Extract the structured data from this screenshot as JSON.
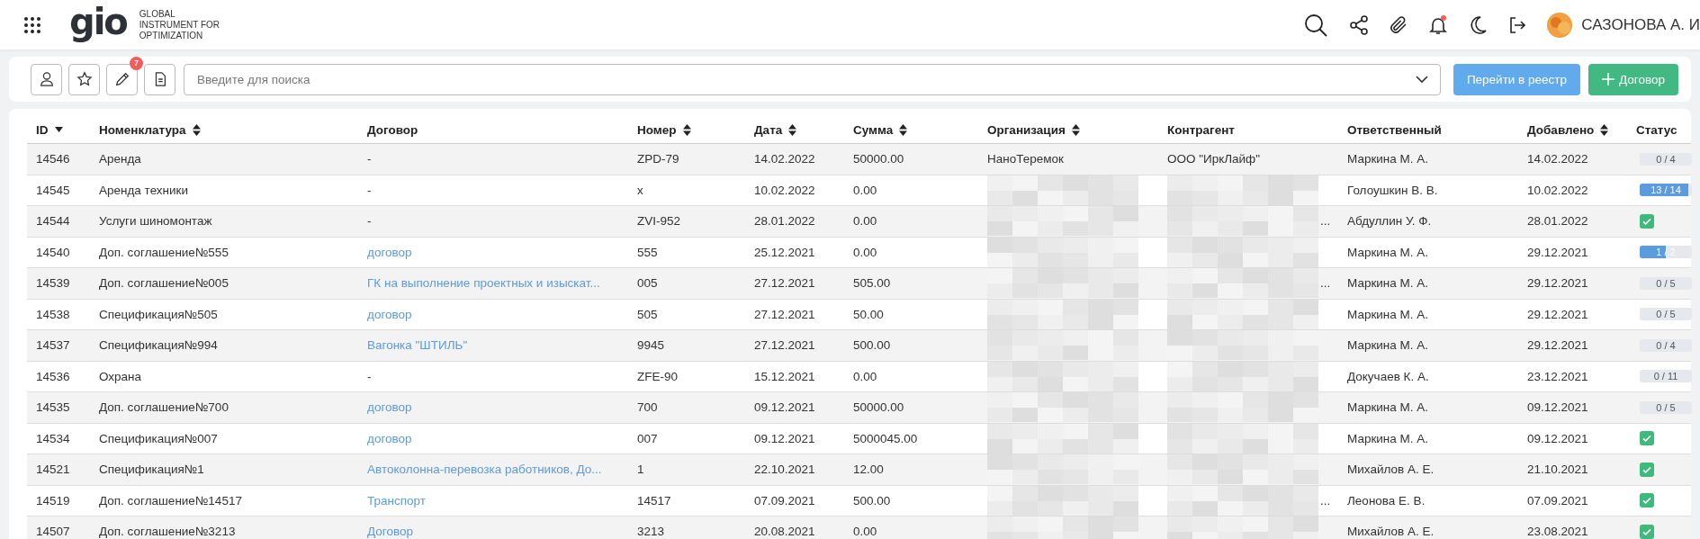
{
  "header": {
    "logo": "gio",
    "logo_caption": [
      "GLOBAL",
      "INSTRUMENT FOR",
      "OPTIMIZATION"
    ],
    "notifications_unread": true,
    "user_name": "САЗОНОВА А. И"
  },
  "toolbar": {
    "pencil_badge": "7",
    "search": {
      "placeholder": "Введите для поиска"
    },
    "buttons": [
      {
        "label": "Перейти в реестр",
        "kind": "primary"
      },
      {
        "label": "Договор",
        "kind": "add"
      }
    ]
  },
  "table": {
    "columns": [
      {
        "label": "ID",
        "sortable": true,
        "sorted_desc": true
      },
      {
        "label": "Номенклатура",
        "sortable": true,
        "sorted_desc": false
      },
      {
        "label": "Договор",
        "sortable": false
      },
      {
        "label": "Номер",
        "sortable": true,
        "sorted_desc": false
      },
      {
        "label": "Дата",
        "sortable": true,
        "sorted_desc": false
      },
      {
        "label": "Сумма",
        "sortable": true,
        "sorted_desc": false
      },
      {
        "label": "Организация",
        "sortable": true,
        "sorted_desc": false
      },
      {
        "label": "Контрагент",
        "sortable": false
      },
      {
        "label": "Ответственный",
        "sortable": false
      },
      {
        "label": "Добавлено",
        "sortable": true,
        "sorted_desc": false
      },
      {
        "label": "Статус",
        "sortable": false
      }
    ],
    "rows": [
      {
        "id": "14546",
        "item": "Аренда",
        "contract": "-",
        "contract_link": false,
        "number": "ZPD-79",
        "date": "14.02.2022",
        "sum": "50000.00",
        "organization": "НаноТеремок",
        "contractor": "ООО \"ИркЛайф\"",
        "redacted": false,
        "responsible": "Маркина М. А.",
        "added": "14.02.2022",
        "status": {
          "kind": "progress",
          "text": "0 / 4",
          "level": 0
        }
      },
      {
        "id": "14545",
        "item": "Аренда техники",
        "contract": "-",
        "contract_link": false,
        "number": "x",
        "date": "10.02.2022",
        "sum": "0.00",
        "redacted": true,
        "responsible": "Голоушкин В. В.",
        "added": "10.02.2022",
        "status": {
          "kind": "progress",
          "text": "13 / 14",
          "level": 0.93
        }
      },
      {
        "id": "14544",
        "item": "Услуги шиномонтаж",
        "contract": "-",
        "contract_link": false,
        "number": "ZVI-952",
        "date": "28.01.2022",
        "sum": "0.00",
        "redacted": true,
        "contractor": "...",
        "responsible": "Абдуллин У. Ф.",
        "added": "28.01.2022",
        "status": {
          "kind": "done"
        }
      },
      {
        "id": "14540",
        "item": "Доп. соглашение№555",
        "contract": "договор",
        "contract_link": true,
        "number": "555",
        "date": "25.12.2021",
        "sum": "0.00",
        "redacted": true,
        "responsible": "Маркина М. А.",
        "added": "29.12.2021",
        "status": {
          "kind": "progress",
          "text": "1 / 2",
          "level": 0.5
        }
      },
      {
        "id": "14539",
        "item": "Доп. соглашение№005",
        "contract": "ГК на выполнение проектных и изыскат...",
        "contract_link": true,
        "number": "005",
        "date": "27.12.2021",
        "sum": "505.00",
        "redacted": true,
        "contractor": "...",
        "responsible": "Маркина М. А.",
        "added": "29.12.2021",
        "status": {
          "kind": "progress",
          "text": "0 / 5",
          "level": 0
        }
      },
      {
        "id": "14538",
        "item": "Спецификация№505",
        "contract": "договор",
        "contract_link": true,
        "number": "505",
        "date": "27.12.2021",
        "sum": "50.00",
        "redacted": true,
        "responsible": "Маркина М. А.",
        "added": "29.12.2021",
        "status": {
          "kind": "progress",
          "text": "0 / 5",
          "level": 0
        }
      },
      {
        "id": "14537",
        "item": "Спецификация№994",
        "contract": "Вагонка \"ШТИЛЬ\"",
        "contract_link": true,
        "number": "9945",
        "date": "27.12.2021",
        "sum": "500.00",
        "redacted": true,
        "responsible": "Маркина М. А.",
        "added": "29.12.2021",
        "status": {
          "kind": "progress",
          "text": "0 / 4",
          "level": 0
        }
      },
      {
        "id": "14536",
        "item": "Охрана",
        "contract": "-",
        "contract_link": false,
        "number": "ZFE-90",
        "date": "15.12.2021",
        "sum": "0.00",
        "redacted": true,
        "responsible": "Докучаев К. А.",
        "added": "23.12.2021",
        "status": {
          "kind": "progress",
          "text": "0 / 11",
          "level": 0
        }
      },
      {
        "id": "14535",
        "item": "Доп. соглашение№700",
        "contract": "договор",
        "contract_link": true,
        "number": "700",
        "date": "09.12.2021",
        "sum": "50000.00",
        "redacted": true,
        "responsible": "Маркина М. А.",
        "added": "09.12.2021",
        "status": {
          "kind": "progress",
          "text": "0 / 5",
          "level": 0
        }
      },
      {
        "id": "14534",
        "item": "Спецификация№007",
        "contract": "договор",
        "contract_link": true,
        "number": "007",
        "date": "09.12.2021",
        "sum": "5000045.00",
        "redacted": true,
        "responsible": "Маркина М. А.",
        "added": "09.12.2021",
        "status": {
          "kind": "done"
        }
      },
      {
        "id": "14521",
        "item": "Спецификация№1",
        "contract": "Автоколонна-перевозка работников, До...",
        "contract_link": true,
        "number": "1",
        "date": "22.10.2021",
        "sum": "12.00",
        "redacted": true,
        "responsible": "Михайлов А. Е.",
        "added": "21.10.2021",
        "status": {
          "kind": "done"
        }
      },
      {
        "id": "14519",
        "item": "Доп. соглашение№14517",
        "contract": "Транспорт",
        "contract_link": true,
        "number": "14517",
        "date": "07.09.2021",
        "sum": "500.00",
        "redacted": true,
        "contractor": "...",
        "responsible": "Леонова Е. В.",
        "added": "07.09.2021",
        "status": {
          "kind": "done"
        }
      },
      {
        "id": "14507",
        "item": "Доп. соглашение№3213",
        "contract": "Договор",
        "contract_link": true,
        "number": "3213",
        "date": "20.08.2021",
        "sum": "0.00",
        "redacted": true,
        "responsible": "Михайлов А. Е.",
        "added": "23.08.2021",
        "status": {
          "kind": "done"
        }
      }
    ]
  }
}
